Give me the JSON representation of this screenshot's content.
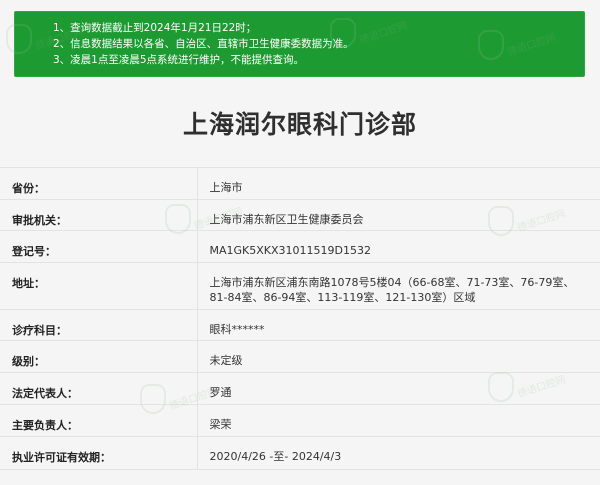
{
  "notice": {
    "lines": [
      "1、查询数据截止到2024年1月21日22时；",
      "2、信息数据结果以各省、自治区、直辖市卫生健康委数据为准。",
      "3、凌晨1点至凌晨5点系统进行维护，不能提供查询。"
    ]
  },
  "page_title": "上海润尔眼科门诊部",
  "table": {
    "rows": [
      {
        "label": "省份：",
        "value": "上海市"
      },
      {
        "label": "审批机关：",
        "value": "上海市浦东新区卫生健康委员会"
      },
      {
        "label": "登记号：",
        "value": "MA1GK5XKX31011519D1532"
      },
      {
        "label": "地址：",
        "value": "上海市浦东新区浦东南路1078号5楼04（66-68室、71-73室、76-79室、81-84室、86-94室、113-119室、121-130室）区域"
      },
      {
        "label": "诊疗科目：",
        "value": "眼科******"
      },
      {
        "label": "级别：",
        "value": "未定级"
      },
      {
        "label": "法定代表人：",
        "value": "罗通"
      },
      {
        "label": "主要负责人：",
        "value": "梁荣"
      },
      {
        "label": "执业许可证有效期：",
        "value": "2020/4/26 -至- 2024/4/3"
      }
    ]
  },
  "watermark_text": "德语口腔网",
  "colors": {
    "notice_bg": "#1e9a32",
    "background": "#f5f5f5",
    "border": "#e3e3e3"
  }
}
